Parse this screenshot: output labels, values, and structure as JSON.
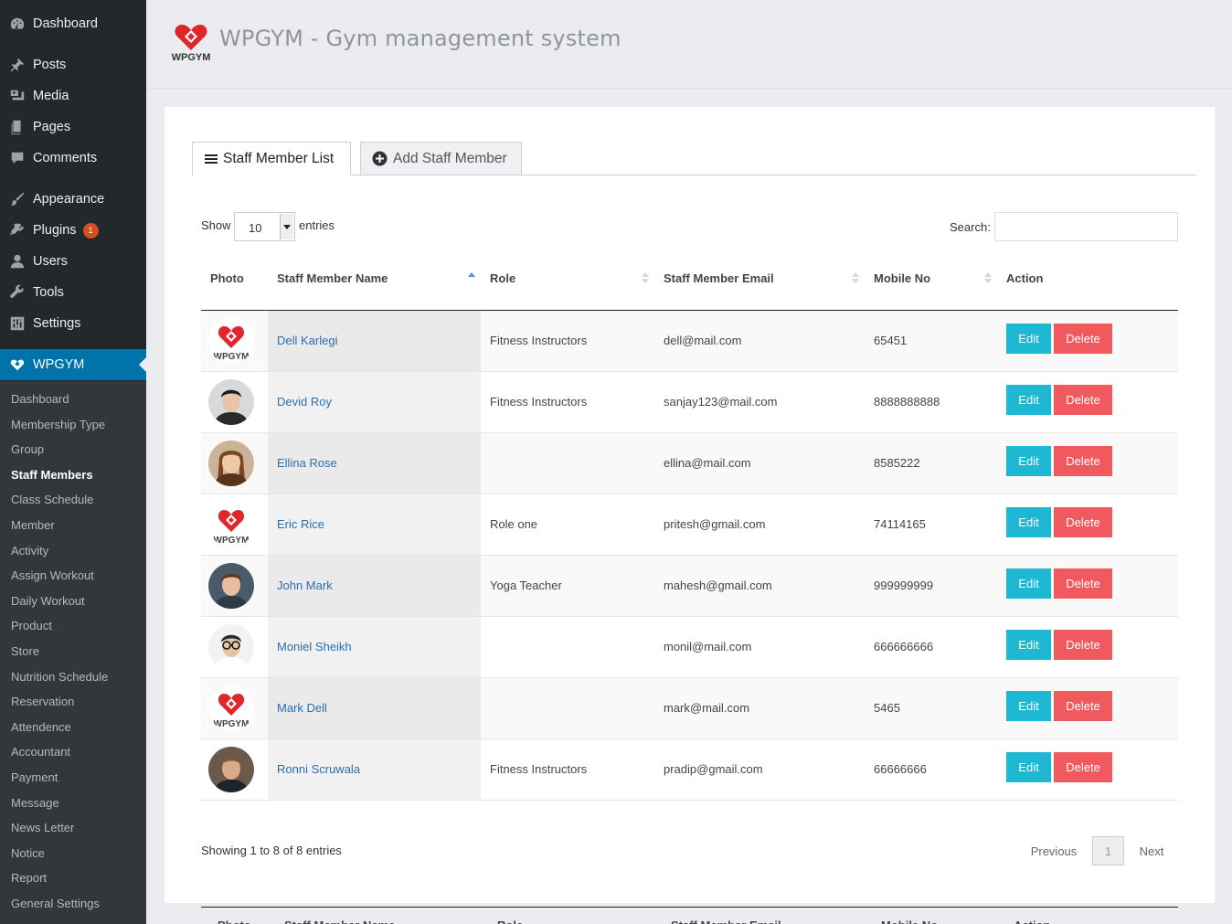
{
  "sidebar": {
    "menu": [
      {
        "label": "Dashboard",
        "icon": "dashboard-icon"
      },
      {
        "label": "Posts",
        "icon": "pin-icon"
      },
      {
        "label": "Media",
        "icon": "media-icon"
      },
      {
        "label": "Pages",
        "icon": "pages-icon"
      },
      {
        "label": "Comments",
        "icon": "comment-icon"
      },
      {
        "label": "Appearance",
        "icon": "brush-icon"
      },
      {
        "label": "Plugins",
        "icon": "plugin-icon",
        "badge": "1"
      },
      {
        "label": "Users",
        "icon": "user-icon"
      },
      {
        "label": "Tools",
        "icon": "wrench-icon"
      },
      {
        "label": "Settings",
        "icon": "settings-icon"
      },
      {
        "label": "WPGYM",
        "icon": "wpgym-heart-icon",
        "active": true
      }
    ],
    "submenu": [
      "Dashboard",
      "Membership Type",
      "Group",
      "Staff Members",
      "Class Schedule",
      "Member",
      "Activity",
      "Assign Workout",
      "Daily Workout",
      "Product",
      "Store",
      "Nutrition Schedule",
      "Reservation",
      "Attendence",
      "Accountant",
      "Payment",
      "Message",
      "News Letter",
      "Notice",
      "Report",
      "General Settings"
    ],
    "current_submenu": "Staff Members"
  },
  "header": {
    "title": "WPGYM - Gym management system",
    "logo_text": "WPGYM"
  },
  "tabs": {
    "list_label": "Staff Member List",
    "add_label": "Add Staff Member"
  },
  "controls": {
    "show_label": "Show",
    "page_length": "10",
    "entries_label": "entries",
    "search_label": "Search:",
    "search_value": ""
  },
  "table": {
    "columns": [
      "Photo",
      "Staff Member Name",
      "Role",
      "Staff Member Email",
      "Mobile No",
      "Action"
    ],
    "sorted_column": "Staff Member Name",
    "sort_direction": "ascending",
    "rows": [
      {
        "photo": "wpgym-logo",
        "name": "Dell Karlegi",
        "role": "Fitness Instructors",
        "email": "dell@mail.com",
        "mobile": "65451"
      },
      {
        "photo": "avatar-man-dark-hair",
        "name": "Devid Roy",
        "role": "Fitness Instructors",
        "email": "sanjay123@mail.com",
        "mobile": "8888888888"
      },
      {
        "photo": "avatar-woman-brown-hair",
        "name": "Ellina Rose",
        "role": "",
        "email": "ellina@mail.com",
        "mobile": "8585222"
      },
      {
        "photo": "wpgym-logo",
        "name": "Eric Rice",
        "role": "Role one",
        "email": "pritesh@gmail.com",
        "mobile": "74114165"
      },
      {
        "photo": "avatar-man-smiling",
        "name": "John Mark",
        "role": "Yoga Teacher",
        "email": "mahesh@gmail.com",
        "mobile": "999999999"
      },
      {
        "photo": "avatar-man-glasses",
        "name": "Moniel Sheikh",
        "role": "",
        "email": "monil@mail.com",
        "mobile": "666666666"
      },
      {
        "photo": "wpgym-logo",
        "name": "Mark Dell",
        "role": "",
        "email": "mark@mail.com",
        "mobile": "5465"
      },
      {
        "photo": "avatar-man-suit",
        "name": "Ronni Scruwala",
        "role": "Fitness Instructors",
        "email": "pradip@gmail.com",
        "mobile": "66666666"
      }
    ],
    "edit_label": "Edit",
    "delete_label": "Delete",
    "edit_color": "#1eb8d3",
    "delete_color": "#f05a5e"
  },
  "footer": {
    "info": "Showing 1 to 8 of 8 entries",
    "previous": "Previous",
    "current_page": "1",
    "next": "Next"
  },
  "colors": {
    "sidebar_bg": "#23282d",
    "submenu_bg": "#32373c",
    "active_menu": "#0073aa",
    "brand_red": "#e0262d",
    "link": "#2a6fb0"
  }
}
